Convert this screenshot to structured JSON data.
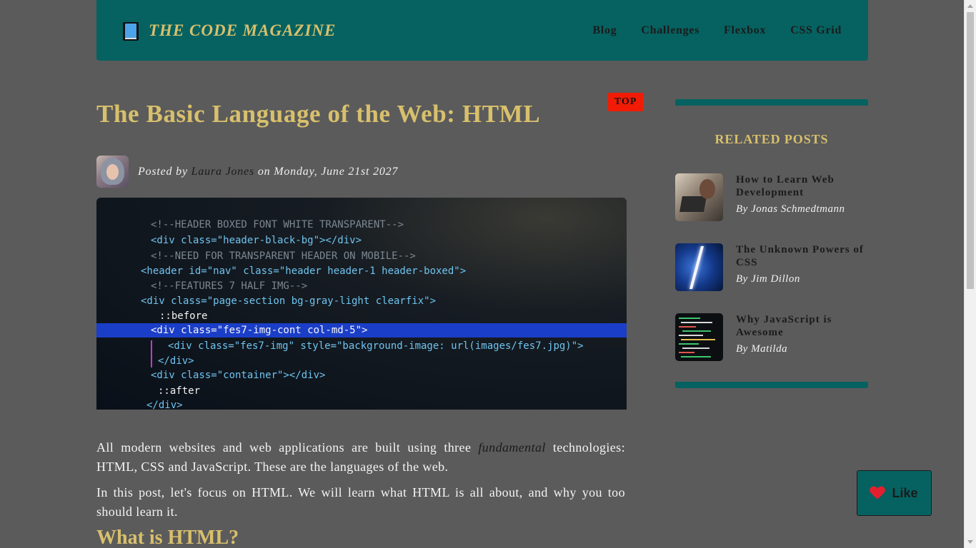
{
  "header": {
    "logo_icon": "book-icon",
    "logo_text": "THE CODE MAGAZINE",
    "nav": [
      "Blog",
      "Challenges",
      "Flexbox",
      "CSS Grid"
    ]
  },
  "post": {
    "title": "The Basic Language of the Web: HTML",
    "badge": "TOP",
    "meta": {
      "prefix": "Posted by",
      "author": "Laura Jones",
      "date_text": "on Monday, June 21st 2027"
    },
    "paragraph1": {
      "before": "All modern websites and web applications are built using three",
      "em": "fundamental",
      "after": "technologies: HTML, CSS and JavaScript. These are the languages of the web."
    },
    "paragraph2": "In this post, let's focus on HTML. We will learn what HTML is all about, and why you too should learn it.",
    "heading2": "What is HTML?"
  },
  "sidebar": {
    "title": "RELATED POSTS",
    "items": [
      {
        "title": "How to Learn Web Development",
        "author": "By Jonas Schmedtmann"
      },
      {
        "title": "The Unknown Powers of CSS",
        "author": "By Jim Dillon"
      },
      {
        "title": "Why JavaScript is Awesome",
        "author": "By Matilda"
      }
    ]
  },
  "like": {
    "label": "Like",
    "icon": "heart-icon"
  },
  "hero_code": [
    "<!--HEADER BOXED FONT WHITE TRANSPARENT-->",
    "<div class=\"header-black-bg\"></div>",
    "<!--NEED FOR TRANSPARENT HEADER ON MOBILE-->",
    "<header id=\"nav\" class=\"header header-1 header-boxed\">",
    "<!--FEATURES 7 HALF IMG-->",
    "<div class=\"page-section bg-gray-light clearfix\">",
    "::before",
    "<div class=\"fes7-img-cont col-md-5\">",
    "<div class=\"fes7-img\" style=\"background-image: url(images/fes7.jpg)\">",
    "</div>",
    "<div class=\"container\"></div>",
    "::after",
    "</div>"
  ],
  "colors": {
    "background": "#5b5b5b",
    "accent": "#056261",
    "gold": "#d8c06c",
    "badge": "#f21b05"
  }
}
